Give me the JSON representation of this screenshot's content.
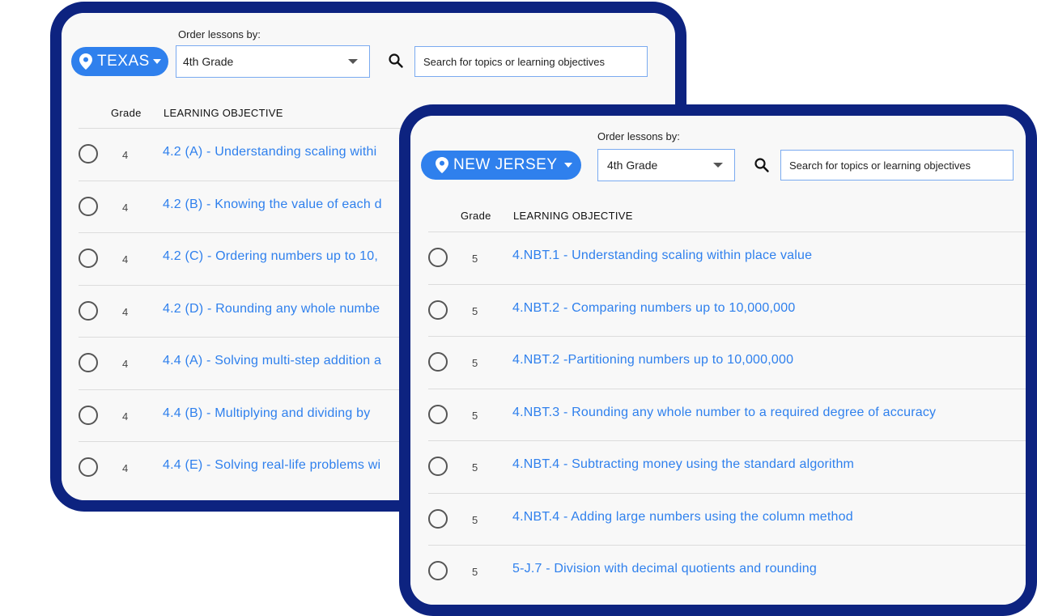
{
  "order_label": "Order lessons by:",
  "grade_header": "Grade",
  "objective_header": "LEARNING OBJECTIVE",
  "search_placeholder": "Search for topics or learning objectives",
  "colors": {
    "frame": "#0d2380",
    "accent": "#2f80ed"
  },
  "texas": {
    "state": "TEXAS",
    "grade_selected": "4th Grade",
    "rows": [
      {
        "grade": "4",
        "objective": "4.2 (A) - Understanding scaling withi"
      },
      {
        "grade": "4",
        "objective": "4.2 (B) - Knowing the value of each d"
      },
      {
        "grade": "4",
        "objective": "4.2 (C) - Ordering numbers up to 10,"
      },
      {
        "grade": "4",
        "objective": "4.2 (D) - Rounding any whole numbe"
      },
      {
        "grade": "4",
        "objective": "4.4 (A) - Solving multi-step addition a"
      },
      {
        "grade": "4",
        "objective": "4.4 (B) - Multiplying and dividing by"
      },
      {
        "grade": "4",
        "objective": "4.4 (E) - Solving real-life problems wi"
      }
    ]
  },
  "new_jersey": {
    "state": "NEW JERSEY",
    "grade_selected": "4th Grade",
    "rows": [
      {
        "grade": "5",
        "objective": "4.NBT.1 - Understanding scaling within place value"
      },
      {
        "grade": "5",
        "objective": "4.NBT.2 - Comparing numbers up to 10,000,000"
      },
      {
        "grade": "5",
        "objective": "4.NBT.2 -Partitioning numbers up to 10,000,000"
      },
      {
        "grade": "5",
        "objective": "4.NBT.3 - Rounding any whole number to a required degree of accuracy"
      },
      {
        "grade": "5",
        "objective": "4.NBT.4 - Subtracting money using the standard algorithm"
      },
      {
        "grade": "5",
        "objective": "4.NBT.4 - Adding large numbers using the column method"
      },
      {
        "grade": "5",
        "objective": "5-J.7 - Division with decimal quotients and rounding"
      }
    ]
  }
}
